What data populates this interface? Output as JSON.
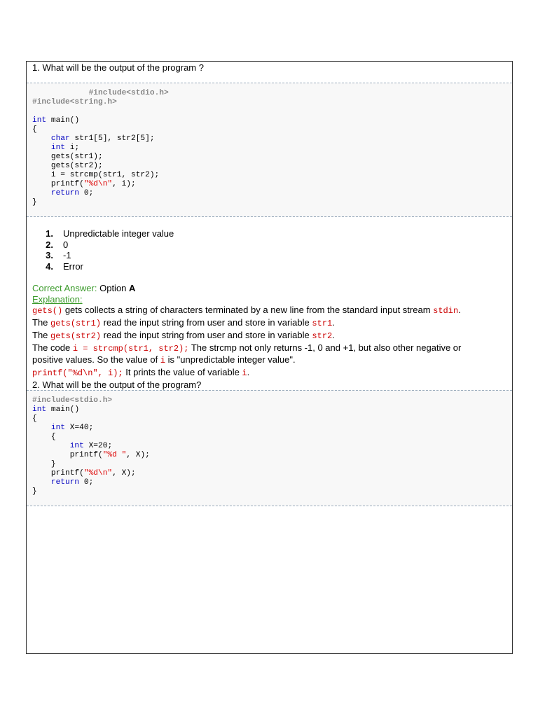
{
  "q1": {
    "question": "1. What will be the output of the program ?",
    "code": [
      [
        [
          "            ",
          ""
        ],
        [
          "#include<stdio.h>",
          "p"
        ]
      ],
      [
        [
          "#include<string.h>",
          "p"
        ]
      ],
      [
        [
          "",
          ""
        ]
      ],
      [
        [
          "int",
          "k"
        ],
        [
          " main()",
          ""
        ]
      ],
      [
        [
          "{",
          ""
        ]
      ],
      [
        [
          "    ",
          ""
        ],
        [
          "char",
          "k"
        ],
        [
          " str1[5], str2[5];",
          ""
        ]
      ],
      [
        [
          "    ",
          ""
        ],
        [
          "int",
          "k"
        ],
        [
          " i;",
          ""
        ]
      ],
      [
        [
          "    gets(str1);",
          ""
        ]
      ],
      [
        [
          "    gets(str2);",
          ""
        ]
      ],
      [
        [
          "    i = strcmp(str1, str2);",
          ""
        ]
      ],
      [
        [
          "    printf(",
          ""
        ],
        [
          "\"%d\\n\"",
          "s"
        ],
        [
          ", i);",
          ""
        ]
      ],
      [
        [
          "    ",
          ""
        ],
        [
          "return",
          "k"
        ],
        [
          " 0;",
          ""
        ]
      ],
      [
        [
          "}",
          ""
        ]
      ]
    ],
    "options": [
      {
        "num": "1.",
        "text": "Unpredictable integer value"
      },
      {
        "num": "2.",
        "text": "0"
      },
      {
        "num": "3.",
        "text": "-1"
      },
      {
        "num": "4.",
        "text": "Error"
      }
    ],
    "answer_label": "Correct Answer:",
    "answer_text": " Option ",
    "answer_letter": "A",
    "explanation_label": "Explanation:",
    "explanation": [
      [
        [
          "gets()",
          "m"
        ],
        [
          " gets collects a string of characters terminated by a new line from the standard input stream ",
          ""
        ],
        [
          "stdin",
          "m"
        ],
        [
          ".",
          ""
        ]
      ],
      [
        [
          "The ",
          ""
        ],
        [
          "gets(str1)",
          "m"
        ],
        [
          " read the input string from user and store in variable ",
          ""
        ],
        [
          "str1",
          "m"
        ],
        [
          ".",
          ""
        ]
      ],
      [
        [
          "The ",
          ""
        ],
        [
          "gets(str2)",
          "m"
        ],
        [
          " read the input string from user and store in variable ",
          ""
        ],
        [
          "str2",
          "m"
        ],
        [
          ".",
          ""
        ]
      ],
      [
        [
          "The code ",
          ""
        ],
        [
          "i = strcmp(str1, str2);",
          "m"
        ],
        [
          " The strcmp not only returns -1, 0 and +1, but also other negative or",
          ""
        ]
      ],
      [
        [
          "positive values. So the value of ",
          ""
        ],
        [
          "i",
          "m"
        ],
        [
          " is \"unpredictable integer value\".",
          ""
        ]
      ],
      [
        [
          "printf(\"%d\\n\", i);",
          "m"
        ],
        [
          " It prints the value of variable ",
          ""
        ],
        [
          "i",
          "m"
        ],
        [
          ".",
          ""
        ]
      ]
    ]
  },
  "q2": {
    "question": "2. What will be the output of the program?",
    "code": [
      [
        [
          "#include<stdio.h>",
          "p"
        ]
      ],
      [
        [
          "int",
          "k"
        ],
        [
          " main()",
          ""
        ]
      ],
      [
        [
          "{",
          ""
        ]
      ],
      [
        [
          "    ",
          ""
        ],
        [
          "int",
          "k"
        ],
        [
          " X=40;",
          ""
        ]
      ],
      [
        [
          "    {",
          ""
        ]
      ],
      [
        [
          "        ",
          ""
        ],
        [
          "int",
          "k"
        ],
        [
          " X=20;",
          ""
        ]
      ],
      [
        [
          "        printf(",
          ""
        ],
        [
          "\"%d \"",
          "s"
        ],
        [
          ", X);",
          ""
        ]
      ],
      [
        [
          "    }",
          ""
        ]
      ],
      [
        [
          "    printf(",
          ""
        ],
        [
          "\"%d\\n\"",
          "s"
        ],
        [
          ", X);",
          ""
        ]
      ],
      [
        [
          "    ",
          ""
        ],
        [
          "return",
          "k"
        ],
        [
          " 0;",
          ""
        ]
      ],
      [
        [
          "}",
          ""
        ]
      ]
    ]
  }
}
